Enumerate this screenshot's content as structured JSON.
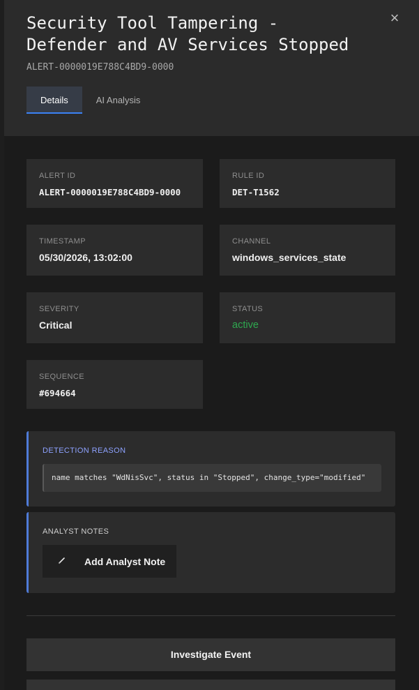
{
  "header": {
    "title": "Security Tool Tampering - Defender and AV Services Stopped",
    "subtitle": "ALERT-0000019E788C4BD9-0000",
    "close_icon": "×"
  },
  "tabs": [
    {
      "label": "Details",
      "active": true
    },
    {
      "label": "AI Analysis",
      "active": false
    }
  ],
  "fields": {
    "alert_id": {
      "label": "ALERT ID",
      "value": "ALERT-0000019E788C4BD9-0000"
    },
    "rule_id": {
      "label": "RULE ID",
      "value": "DET-T1562"
    },
    "timestamp": {
      "label": "TIMESTAMP",
      "value": "05/30/2026, 13:02:00"
    },
    "channel": {
      "label": "CHANNEL",
      "value": "windows_services_state"
    },
    "severity": {
      "label": "SEVERITY",
      "value": "Critical"
    },
    "status": {
      "label": "STATUS",
      "value": "active"
    },
    "sequence": {
      "label": "SEQUENCE",
      "value": "#694664"
    }
  },
  "detection": {
    "label": "DETECTION REASON",
    "reason": "name matches \"WdNisSvc\", status in \"Stopped\", change_type=\"modified\""
  },
  "notes": {
    "label": "ANALYST NOTES",
    "add_button": "Add Analyst Note"
  },
  "actions": {
    "investigate": "Investigate Event"
  },
  "colors": {
    "accent": "#3b82f6",
    "status_active": "#2ea94f",
    "detection_label": "#8ea2ff",
    "notes_label": "#d0d0d0"
  }
}
